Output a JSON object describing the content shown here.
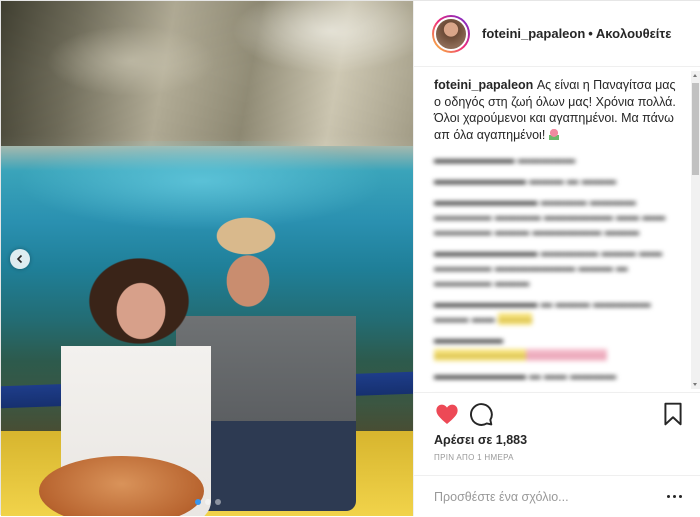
{
  "post": {
    "username": "foteini_papaleon",
    "separator": "•",
    "follow_status": "Ακολουθείτε",
    "caption_user": "foteini_papaleon",
    "caption_text": "Ας είναι η Παναγίτσα μας ο οδηγός στη ζωή όλων μας! Χρόνια πολλά. Όλοι χαρούμενοι και αγαπημένοι. Μα πάνω απ όλα αγαπημένοι!",
    "caption_emoji": "tulip-icon",
    "likes": "Αρέσει σε 1,883",
    "timestamp": "ΠΡΙΝ ΑΠΟ 1 ΗΜΕΡΑ",
    "comment_placeholder": "Προσθέστε ένα σχόλιο...",
    "carousel_dots": 3,
    "carousel_active": 1
  },
  "icons": {
    "like": "heart-icon",
    "comment": "comment-bubble-icon",
    "save": "bookmark-icon",
    "more": "more-options-icon",
    "prev": "chevron-left-icon"
  },
  "colors": {
    "like": "#ed4956",
    "link": "#262626",
    "muted": "#999999",
    "active_dot": "#3897f0"
  }
}
